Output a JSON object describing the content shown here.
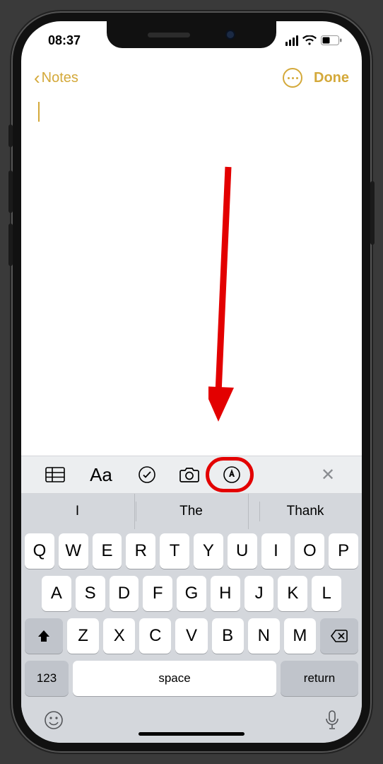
{
  "status": {
    "time": "08:37"
  },
  "nav": {
    "back_label": "Notes",
    "done_label": "Done"
  },
  "note": {
    "content": ""
  },
  "toolbar": {
    "text_format_label": "Aa"
  },
  "suggestions": [
    "I",
    "The",
    "Thank"
  ],
  "keyboard": {
    "row1": [
      "Q",
      "W",
      "E",
      "R",
      "T",
      "Y",
      "U",
      "I",
      "O",
      "P"
    ],
    "row2": [
      "A",
      "S",
      "D",
      "F",
      "G",
      "H",
      "J",
      "K",
      "L"
    ],
    "row3": [
      "Z",
      "X",
      "C",
      "V",
      "B",
      "N",
      "M"
    ],
    "numeric_label": "123",
    "space_label": "space",
    "return_label": "return"
  },
  "annotation": {
    "highlight_target": "camera-button"
  }
}
